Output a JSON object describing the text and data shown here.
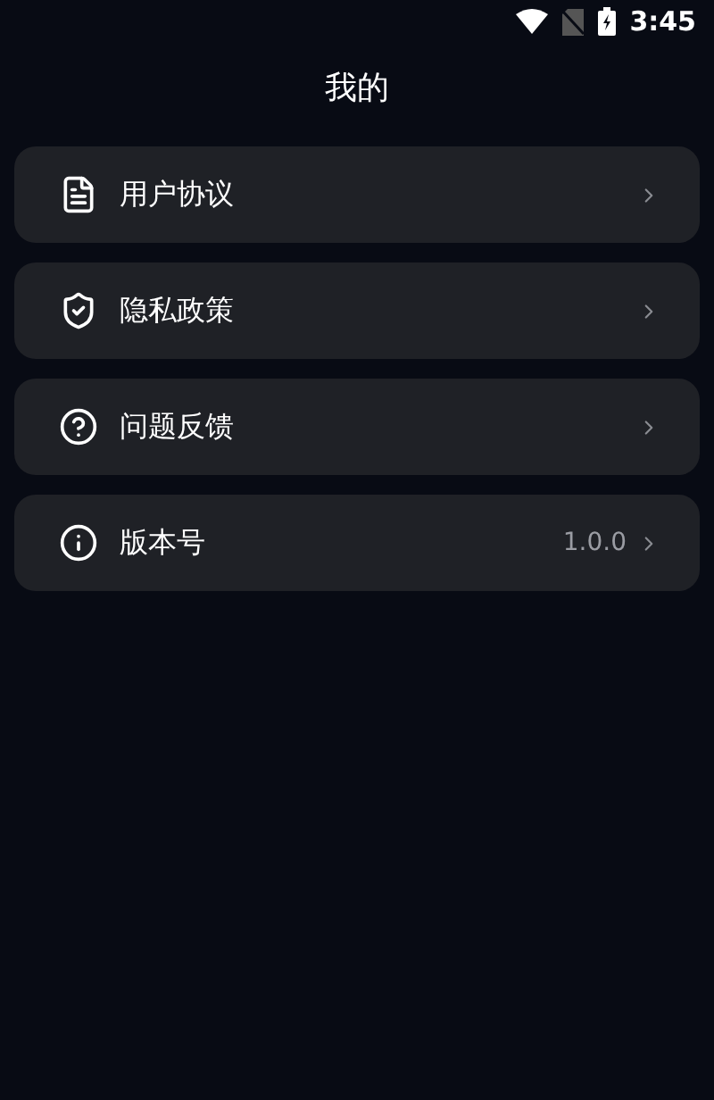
{
  "status_bar": {
    "time": "3:45"
  },
  "title": "我的",
  "items": [
    {
      "kind": "document",
      "label": "用户协议"
    },
    {
      "kind": "shield",
      "label": "隐私政策"
    },
    {
      "kind": "question",
      "label": "问题反馈"
    },
    {
      "kind": "info",
      "label": "版本号",
      "value": "1.0.0"
    }
  ]
}
